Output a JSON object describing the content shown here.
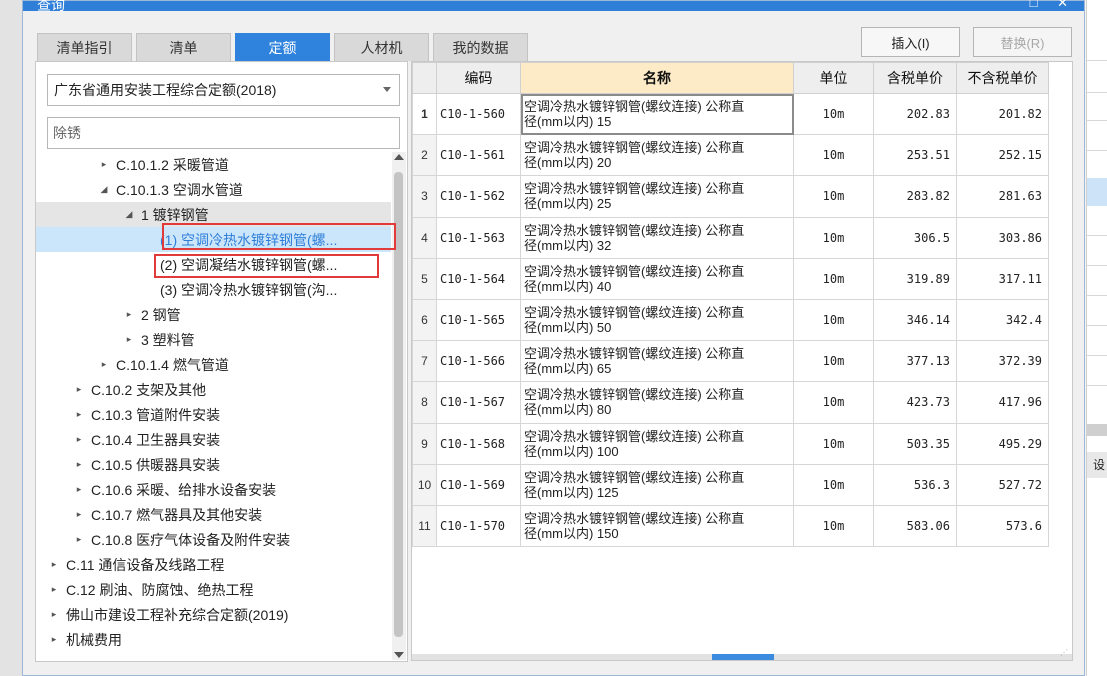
{
  "window": {
    "title": "查询",
    "controls": "□ ✕"
  },
  "tabs": [
    {
      "label": "清单指引",
      "active": false
    },
    {
      "label": "清单",
      "active": false
    },
    {
      "label": "定额",
      "active": true
    },
    {
      "label": "人材机",
      "active": false
    },
    {
      "label": "我的数据",
      "active": false
    }
  ],
  "toolbar": {
    "insert_label": "插入(I)",
    "replace_label": "替换(R)"
  },
  "library_select": {
    "value": "广东省通用安装工程综合定额(2018)"
  },
  "search": {
    "value": "除锈"
  },
  "tree": [
    {
      "toggle": "▸",
      "label": "C.10.1.2 采暖管道",
      "level": 2
    },
    {
      "toggle": "◢",
      "label": "C.10.1.3 空调水管道",
      "level": 2
    },
    {
      "toggle": "◢",
      "label": "1 镀锌钢管",
      "level": 3
    },
    {
      "toggle": "",
      "label": "(1) 空调冷热水镀锌钢管(螺...",
      "level": 4
    },
    {
      "toggle": "",
      "label": "(2) 空调凝结水镀锌钢管(螺...",
      "level": 4
    },
    {
      "toggle": "",
      "label": "(3) 空调冷热水镀锌钢管(沟...",
      "level": 4
    },
    {
      "toggle": "▸",
      "label": "2 钢管",
      "level": 3
    },
    {
      "toggle": "▸",
      "label": "3 塑料管",
      "level": 3
    },
    {
      "toggle": "▸",
      "label": "C.10.1.4 燃气管道",
      "level": 2
    },
    {
      "toggle": "▸",
      "label": "C.10.2 支架及其他",
      "level": 1
    },
    {
      "toggle": "▸",
      "label": "C.10.3 管道附件安装",
      "level": 1
    },
    {
      "toggle": "▸",
      "label": "C.10.4 卫生器具安装",
      "level": 1
    },
    {
      "toggle": "▸",
      "label": "C.10.5 供暖器具安装",
      "level": 1
    },
    {
      "toggle": "▸",
      "label": "C.10.6 采暖、给排水设备安装",
      "level": 1
    },
    {
      "toggle": "▸",
      "label": "C.10.7 燃气器具及其他安装",
      "level": 1
    },
    {
      "toggle": "▸",
      "label": "C.10.8 医疗气体设备及附件安装",
      "level": 1
    },
    {
      "toggle": "▸",
      "label": "C.11 通信设备及线路工程",
      "level": 0
    },
    {
      "toggle": "▸",
      "label": "C.12 刷油、防腐蚀、绝热工程",
      "level": 0
    },
    {
      "toggle": "▸",
      "label": "佛山市建设工程补充综合定额(2019)",
      "level": 0
    },
    {
      "toggle": "▸",
      "label": "机械费用",
      "level": 0
    }
  ],
  "table": {
    "headers": {
      "code": "编码",
      "name": "名称",
      "unit": "单位",
      "tax_price": "含税单价",
      "notax_price": "不含税单价"
    },
    "rows": [
      {
        "idx": "1",
        "code": "C10-1-560",
        "name1": "空调冷热水镀锌钢管(螺纹连接) 公称直",
        "name2": "径(mm以内) 15",
        "unit": "10m",
        "tax": "202.83",
        "notax": "201.82"
      },
      {
        "idx": "2",
        "code": "C10-1-561",
        "name1": "空调冷热水镀锌钢管(螺纹连接) 公称直",
        "name2": "径(mm以内) 20",
        "unit": "10m",
        "tax": "253.51",
        "notax": "252.15"
      },
      {
        "idx": "3",
        "code": "C10-1-562",
        "name1": "空调冷热水镀锌钢管(螺纹连接) 公称直",
        "name2": "径(mm以内) 25",
        "unit": "10m",
        "tax": "283.82",
        "notax": "281.63"
      },
      {
        "idx": "4",
        "code": "C10-1-563",
        "name1": "空调冷热水镀锌钢管(螺纹连接) 公称直",
        "name2": "径(mm以内) 32",
        "unit": "10m",
        "tax": "306.5",
        "notax": "303.86"
      },
      {
        "idx": "5",
        "code": "C10-1-564",
        "name1": "空调冷热水镀锌钢管(螺纹连接) 公称直",
        "name2": "径(mm以内) 40",
        "unit": "10m",
        "tax": "319.89",
        "notax": "317.11"
      },
      {
        "idx": "6",
        "code": "C10-1-565",
        "name1": "空调冷热水镀锌钢管(螺纹连接) 公称直",
        "name2": "径(mm以内) 50",
        "unit": "10m",
        "tax": "346.14",
        "notax": "342.4"
      },
      {
        "idx": "7",
        "code": "C10-1-566",
        "name1": "空调冷热水镀锌钢管(螺纹连接) 公称直",
        "name2": "径(mm以内) 65",
        "unit": "10m",
        "tax": "377.13",
        "notax": "372.39"
      },
      {
        "idx": "8",
        "code": "C10-1-567",
        "name1": "空调冷热水镀锌钢管(螺纹连接) 公称直",
        "name2": "径(mm以内) 80",
        "unit": "10m",
        "tax": "423.73",
        "notax": "417.96"
      },
      {
        "idx": "9",
        "code": "C10-1-568",
        "name1": "空调冷热水镀锌钢管(螺纹连接) 公称直",
        "name2": "径(mm以内) 100",
        "unit": "10m",
        "tax": "503.35",
        "notax": "495.29"
      },
      {
        "idx": "10",
        "code": "C10-1-569",
        "name1": "空调冷热水镀锌钢管(螺纹连接) 公称直",
        "name2": "径(mm以内) 125",
        "unit": "10m",
        "tax": "536.3",
        "notax": "527.72"
      },
      {
        "idx": "11",
        "code": "C10-1-570",
        "name1": "空调冷热水镀锌钢管(螺纹连接) 公称直",
        "name2": "径(mm以内) 150",
        "unit": "10m",
        "tax": "583.06",
        "notax": "573.6"
      }
    ]
  },
  "side_app": {
    "tab_fragment": "设"
  },
  "colors": {
    "accent": "#2f83dd",
    "highlight_box": "#e03a3a",
    "header_highlight": "#fdebc8"
  }
}
